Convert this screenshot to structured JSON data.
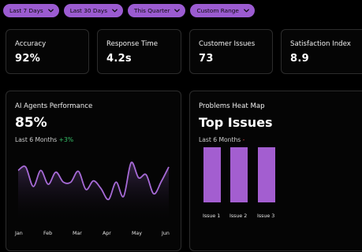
{
  "filters": [
    {
      "label": "Last 7 Days"
    },
    {
      "label": "Last 30 Days"
    },
    {
      "label": "This Quarter"
    },
    {
      "label": "Custom Range"
    }
  ],
  "stats": {
    "accuracy": {
      "label": "Accuracy",
      "value": "92%"
    },
    "response_time": {
      "label": "Response Time",
      "value": "4.2s"
    },
    "customer_issues": {
      "label": "Customer Issues",
      "value": "73"
    },
    "satisfaction": {
      "label": "Satisfaction Index",
      "value": "8.9"
    }
  },
  "performance": {
    "title": "AI Agents Performance",
    "value": "85%",
    "period": "Last 6 Months",
    "change": "+3%"
  },
  "heatmap": {
    "title": "Problems Heat Map",
    "headline": "Top Issues",
    "period": "Last 6 Months",
    "change": "-"
  },
  "chart_data": [
    {
      "type": "line",
      "categories": [
        "Jan",
        "Feb",
        "Mar",
        "Apr",
        "May",
        "Jun"
      ],
      "x": [
        0,
        0.25,
        0.5,
        0.75,
        1,
        1.25,
        1.5,
        1.75,
        2,
        2.25,
        2.5,
        2.75,
        3,
        3.25,
        3.5,
        3.75,
        4,
        4.25,
        4.5,
        4.75,
        5
      ],
      "values": [
        0.72,
        0.8,
        0.35,
        0.72,
        0.4,
        0.68,
        0.45,
        0.45,
        0.7,
        0.28,
        0.48,
        0.3,
        0.05,
        0.45,
        0.12,
        0.9,
        0.55,
        0.62,
        0.18,
        0.46,
        0.8
      ],
      "color": "#a66ad6"
    },
    {
      "type": "bar",
      "categories": [
        "Issue 1",
        "Issue 2",
        "Issue 3"
      ],
      "values": [
        1,
        1,
        1
      ],
      "color": "#a35ed0"
    }
  ]
}
